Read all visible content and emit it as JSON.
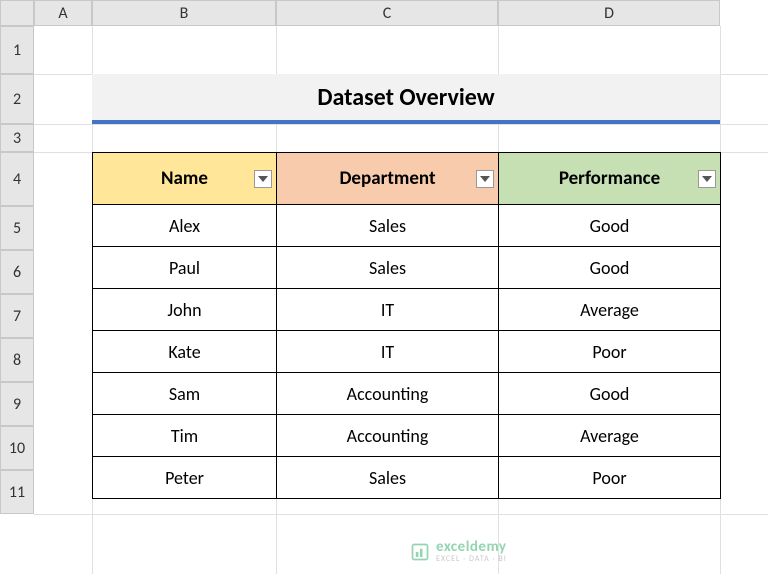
{
  "columns": {
    "A": "A",
    "B": "B",
    "C": "C",
    "D": "D"
  },
  "rows": {
    "r1": "1",
    "r2": "2",
    "r3": "3",
    "r4": "4",
    "r5": "5",
    "r6": "6",
    "r7": "7",
    "r8": "8",
    "r9": "9",
    "r10": "10",
    "r11": "11"
  },
  "title": "Dataset Overview",
  "headers": {
    "name": "Name",
    "department": "Department",
    "performance": "Performance"
  },
  "data": [
    {
      "name": "Alex",
      "department": "Sales",
      "performance": "Good"
    },
    {
      "name": "Paul",
      "department": "Sales",
      "performance": "Good"
    },
    {
      "name": "John",
      "department": "IT",
      "performance": "Average"
    },
    {
      "name": "Kate",
      "department": "IT",
      "performance": "Poor"
    },
    {
      "name": "Sam",
      "department": "Accounting",
      "performance": "Good"
    },
    {
      "name": "Tim",
      "department": "Accounting",
      "performance": "Average"
    },
    {
      "name": "Peter",
      "department": "Sales",
      "performance": "Poor"
    }
  ],
  "watermark": {
    "main": "exceldemy",
    "sub": "EXCEL · DATA · BI"
  },
  "chart_data": {
    "type": "table",
    "title": "Dataset Overview",
    "columns": [
      "Name",
      "Department",
      "Performance"
    ],
    "rows": [
      [
        "Alex",
        "Sales",
        "Good"
      ],
      [
        "Paul",
        "Sales",
        "Good"
      ],
      [
        "John",
        "IT",
        "Average"
      ],
      [
        "Kate",
        "IT",
        "Poor"
      ],
      [
        "Sam",
        "Accounting",
        "Good"
      ],
      [
        "Tim",
        "Accounting",
        "Average"
      ],
      [
        "Peter",
        "Sales",
        "Poor"
      ]
    ]
  }
}
